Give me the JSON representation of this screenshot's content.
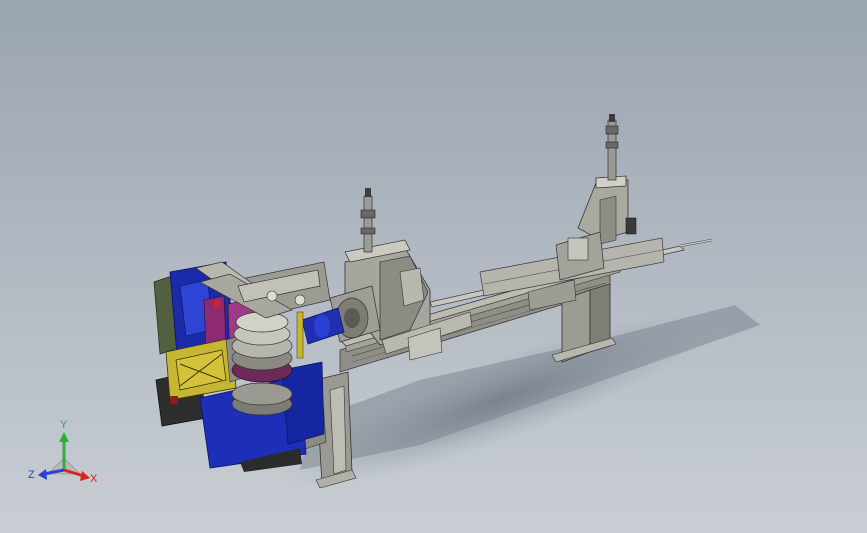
{
  "viewport": {
    "background_top": "#9aa4b0",
    "background_bottom": "#c9ced4"
  },
  "model": {
    "icon": "pipe-bending-machine-3d-model"
  },
  "triad": {
    "x_label": "X",
    "y_label": "Y",
    "z_label": "Z",
    "x_color": "#d6261f",
    "y_color": "#2fae3c",
    "z_color": "#2b43c9"
  }
}
